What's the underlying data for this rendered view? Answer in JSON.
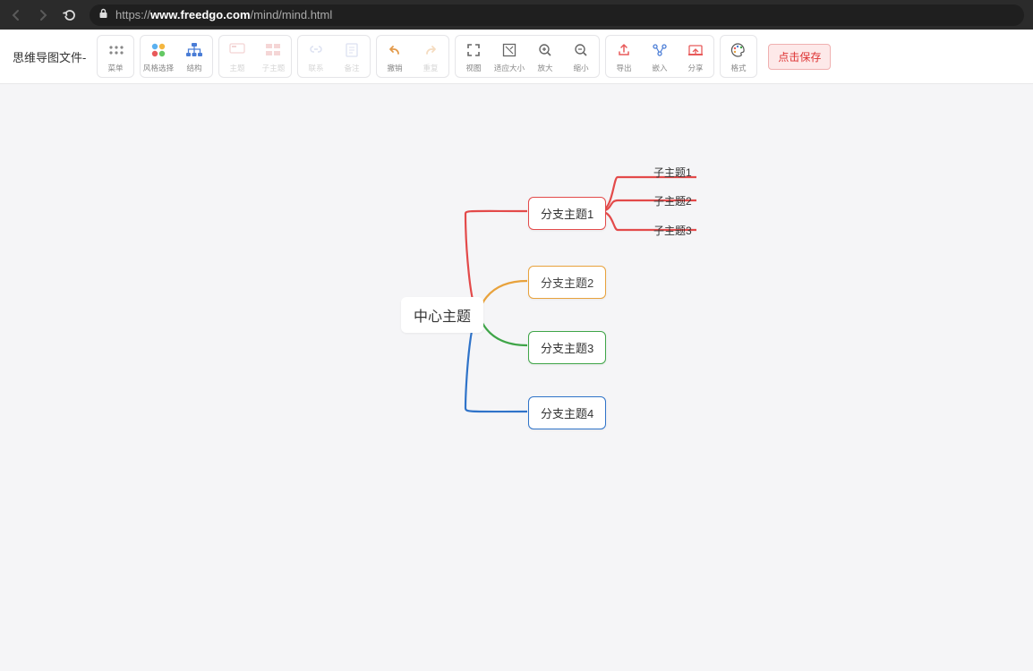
{
  "browser": {
    "url_host": "www.freedgo.com",
    "url_path": "/mind/mind.html",
    "url_scheme": "https://"
  },
  "toolbar": {
    "file_label": "思维导图文件-",
    "save_button": "点击保存",
    "buttons": {
      "menu": "菜单",
      "style": "风格选择",
      "structure": "结构",
      "topic": "主题",
      "subtopic": "子主题",
      "relation": "联系",
      "note": "备注",
      "undo": "撤销",
      "redo": "重复",
      "view": "视图",
      "fit": "适应大小",
      "zoom_in": "放大",
      "zoom_out": "缩小",
      "export": "导出",
      "embed": "嵌入",
      "share": "分享",
      "format": "格式"
    }
  },
  "mindmap": {
    "center": "中心主题",
    "branches": [
      {
        "label": "分支主题1",
        "color": "#e34a4a"
      },
      {
        "label": "分支主题2",
        "color": "#e8a23c"
      },
      {
        "label": "分支主题3",
        "color": "#3fa548"
      },
      {
        "label": "分支主题4",
        "color": "#2f73c9"
      }
    ],
    "subtopics": [
      "子主题1",
      "子主题2",
      "子主题3"
    ]
  }
}
